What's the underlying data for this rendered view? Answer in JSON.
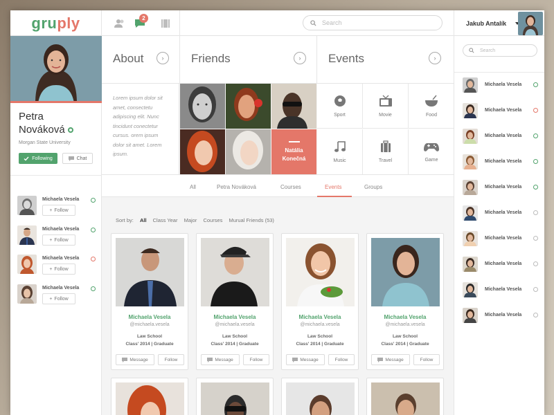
{
  "colors": {
    "accent": "#e47769",
    "green": "#52a36d",
    "online": "#52a36d",
    "busy": "#e47769",
    "offline": "#bbbbbb"
  },
  "topbar": {
    "logo": "gruply",
    "notification_count": "2",
    "search_placeholder": "Search",
    "user_name": "Jakub Antalík"
  },
  "profile": {
    "name_first": "Petra",
    "name_last": "Nováková",
    "university": "Morgan State University",
    "following_label": "Following",
    "chat_label": "Chat"
  },
  "left_friends": [
    {
      "name": "Michaela Vesela",
      "follow_label": "Follow",
      "status": "online"
    },
    {
      "name": "Michaela Vesela",
      "follow_label": "Follow",
      "status": "online"
    },
    {
      "name": "Michaela Vesela",
      "follow_label": "Follow",
      "status": "busy"
    },
    {
      "name": "Michaela Vesela",
      "follow_label": "Follow",
      "status": "online"
    }
  ],
  "panels": {
    "about_title": "About",
    "friends_title": "Friends",
    "events_title": "Events",
    "about_text": "Lorem ipsum dolor sit amet, consectetu adipiscing elit. Nunc tincidunt conectetur cursus. orem ipsum dolor sit amet. Lorem ipsum.",
    "friend_highlight_first": "Natália",
    "friend_highlight_last": "Konečná"
  },
  "events": [
    {
      "label": "Sport",
      "icon": "soccer-ball-icon"
    },
    {
      "label": "Movie",
      "icon": "tv-icon"
    },
    {
      "label": "Food",
      "icon": "bowl-icon"
    },
    {
      "label": "Music",
      "icon": "music-note-icon"
    },
    {
      "label": "Travel",
      "icon": "luggage-icon"
    },
    {
      "label": "Game",
      "icon": "gamepad-icon"
    }
  ],
  "tabs": [
    "All",
    "Petra Nováková",
    "Courses",
    "Events",
    "Groups"
  ],
  "active_tab": "Events",
  "sort": {
    "label": "Sort by:",
    "options": [
      "All",
      "Class Year",
      "Major",
      "Courses",
      "Murual Friends (53)"
    ],
    "selected": "All"
  },
  "cards": [
    {
      "name": "Michaela Vesela",
      "handle": "@michaela.vesela",
      "school": "Law School",
      "class": "Class' 2014 | Graduate",
      "message_label": "Message",
      "follow_label": "Follow"
    },
    {
      "name": "Michaela Vesela",
      "handle": "@michaela.vesela",
      "school": "Law School",
      "class": "Class' 2014 | Graduate",
      "message_label": "Message",
      "follow_label": "Follow"
    },
    {
      "name": "Michaela Vesela",
      "handle": "@michaela.vesela",
      "school": "Law School",
      "class": "Class' 2014 | Graduate",
      "message_label": "Message",
      "follow_label": "Follow"
    },
    {
      "name": "Michaela Vesela",
      "handle": "@michaela.vesela",
      "school": "Law School",
      "class": "Class' 2014 | Graduate",
      "message_label": "Message",
      "follow_label": "Follow"
    }
  ],
  "right": {
    "search_placeholder": "Search",
    "friends": [
      {
        "name": "Michaela Vesela",
        "status": "online"
      },
      {
        "name": "Michaela Vesela",
        "status": "busy"
      },
      {
        "name": "Michaela Vesela",
        "status": "online"
      },
      {
        "name": "Michaela Vesela",
        "status": "online"
      },
      {
        "name": "Michaela Vesela",
        "status": "online"
      },
      {
        "name": "Michaela Vesela",
        "status": "offline"
      },
      {
        "name": "Michaela Vesela",
        "status": "offline"
      },
      {
        "name": "Michaela Vesela",
        "status": "offline"
      },
      {
        "name": "Michaela Vesela",
        "status": "offline"
      },
      {
        "name": "Michaela Vesela",
        "status": "offline"
      }
    ]
  }
}
